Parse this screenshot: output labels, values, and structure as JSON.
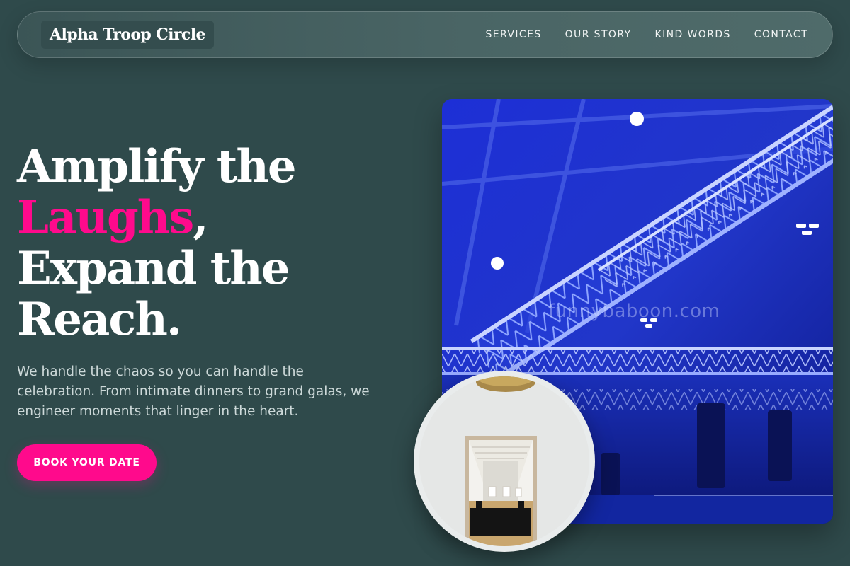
{
  "brand": {
    "name": "Alpha Troop Circle"
  },
  "nav": {
    "items": [
      {
        "label": "SERVICES"
      },
      {
        "label": "OUR STORY"
      },
      {
        "label": "KIND WORDS"
      },
      {
        "label": "CONTACT"
      }
    ]
  },
  "hero": {
    "headline_part1": "Amplify the",
    "headline_accent": "Laughs",
    "headline_comma": ",",
    "headline_part2": "Expand the",
    "headline_part3": "Reach.",
    "subtext": "We handle the chaos so you can handle the celebration. From intimate dinners to grand galas, we engineer moments that linger in the heart.",
    "cta_label": "BOOK YOUR DATE"
  },
  "images": {
    "main": "concert-stage-truss-blue-lights",
    "inset": "gallery-doorway-banquet-hall",
    "watermark": "funnybaboon.com"
  },
  "colors": {
    "background": "#2f4a4b",
    "accent": "#ff0a8c",
    "text": "#ffffff",
    "muted_text": "#cdd9d9"
  }
}
